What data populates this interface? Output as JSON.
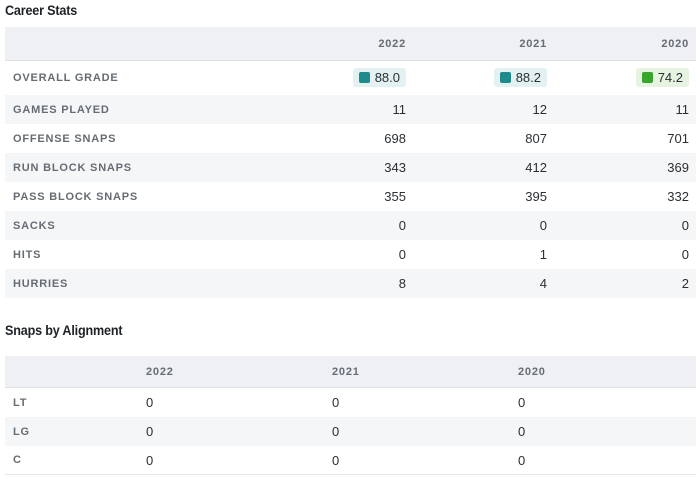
{
  "career": {
    "title": "Career Stats",
    "years": [
      "2022",
      "2021",
      "2020"
    ],
    "grade_row": {
      "label": "OVERALL GRADE",
      "values": [
        {
          "value": "88.0",
          "color": "#1e8a8c"
        },
        {
          "value": "88.2",
          "color": "#1e8a8c"
        },
        {
          "value": "74.2",
          "color": "#3aa52c"
        }
      ]
    },
    "rows": [
      {
        "label": "GAMES PLAYED",
        "values": [
          "11",
          "12",
          "11"
        ]
      },
      {
        "label": "OFFENSE SNAPS",
        "values": [
          "698",
          "807",
          "701"
        ]
      },
      {
        "label": "RUN BLOCK SNAPS",
        "values": [
          "343",
          "412",
          "369"
        ]
      },
      {
        "label": "PASS BLOCK SNAPS",
        "values": [
          "355",
          "395",
          "332"
        ]
      },
      {
        "label": "SACKS",
        "values": [
          "0",
          "0",
          "0"
        ]
      },
      {
        "label": "HITS",
        "values": [
          "0",
          "1",
          "0"
        ]
      },
      {
        "label": "HURRIES",
        "values": [
          "8",
          "4",
          "2"
        ]
      }
    ]
  },
  "alignment": {
    "title": "Snaps by Alignment",
    "years": [
      "2022",
      "2021",
      "2020"
    ],
    "rows": [
      {
        "label": "LT",
        "values": [
          "0",
          "0",
          "0"
        ]
      },
      {
        "label": "LG",
        "values": [
          "0",
          "0",
          "0"
        ]
      },
      {
        "label": "C",
        "values": [
          "0",
          "0",
          "0"
        ]
      }
    ]
  }
}
